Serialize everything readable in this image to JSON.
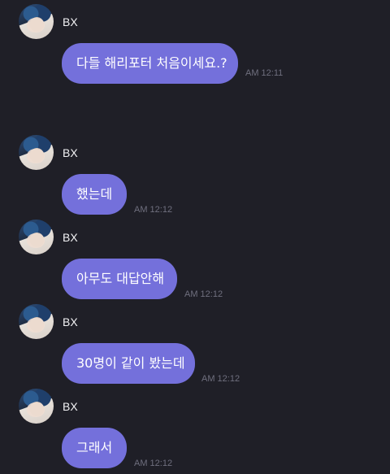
{
  "messages": [
    {
      "sender": "BX",
      "text": "다들 해리포터 처음이세요.?",
      "time": "AM 12:11"
    },
    {
      "sender": "BX",
      "text": "했는데",
      "time": "AM 12:12"
    },
    {
      "sender": "BX",
      "text": "아무도 대답안해",
      "time": "AM 12:12"
    },
    {
      "sender": "BX",
      "text": "30명이 같이 봤는데",
      "time": "AM 12:12"
    },
    {
      "sender": "BX",
      "text": "그래서",
      "time": "AM 12:12"
    }
  ],
  "colors": {
    "background": "#1f1f27",
    "bubble": "#7470db",
    "name": "#f2f2f4",
    "time": "#6f6f7e"
  }
}
